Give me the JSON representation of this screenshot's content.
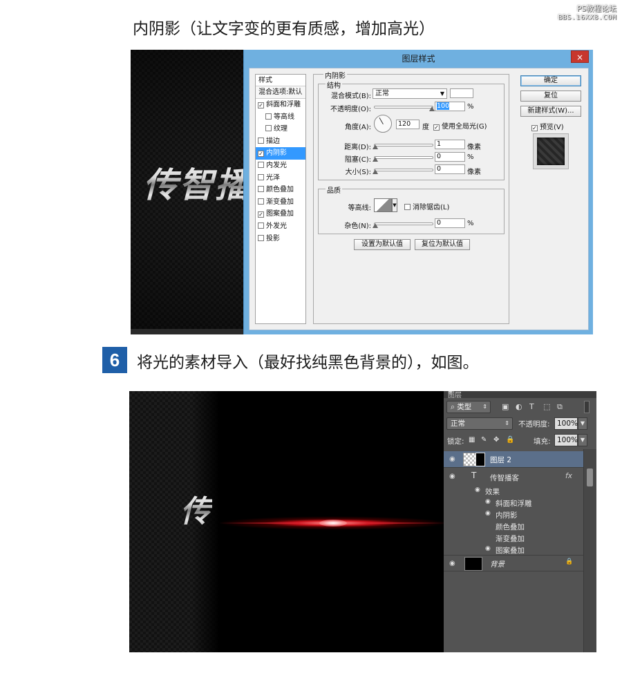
{
  "watermark": {
    "line1": "PS教程论坛",
    "line2": "BBS.16XX8.COM"
  },
  "heading1": "内阴影（让文字变的更有质感，增加高光）",
  "step": {
    "number": "6",
    "text": "将光的素材导入（最好找纯黑色背景的），如图。"
  },
  "shot1": {
    "canvas_text": "传智播",
    "dialog": {
      "title": "图层样式",
      "close": "×",
      "styles_header": "样式",
      "blend_options": "混合选项:默认",
      "style_items": [
        {
          "label": "斜面和浮雕",
          "checked": "✓",
          "sub": false,
          "selected": false
        },
        {
          "label": "等高线",
          "checked": "",
          "sub": true,
          "selected": false
        },
        {
          "label": "纹理",
          "checked": "",
          "sub": true,
          "selected": false
        },
        {
          "label": "描边",
          "checked": "",
          "sub": false,
          "selected": false
        },
        {
          "label": "内阴影",
          "checked": "✓",
          "sub": false,
          "selected": true
        },
        {
          "label": "内发光",
          "checked": "",
          "sub": false,
          "selected": false
        },
        {
          "label": "光泽",
          "checked": "",
          "sub": false,
          "selected": false
        },
        {
          "label": "颜色叠加",
          "checked": "",
          "sub": false,
          "selected": false
        },
        {
          "label": "渐变叠加",
          "checked": "",
          "sub": false,
          "selected": false
        },
        {
          "label": "图案叠加",
          "checked": "✓",
          "sub": false,
          "selected": false
        },
        {
          "label": "外发光",
          "checked": "",
          "sub": false,
          "selected": false
        },
        {
          "label": "投影",
          "checked": "",
          "sub": false,
          "selected": false
        }
      ],
      "section_title": "内阴影",
      "structure_title": "结构",
      "blend_mode_label": "混合模式(B):",
      "blend_mode_value": "正常",
      "opacity_label": "不透明度(O):",
      "opacity_value": "100",
      "percent": "%",
      "angle_label": "角度(A):",
      "angle_value": "120",
      "degree_unit": "度",
      "global_light_label": "使用全局光(G)",
      "global_light_checked": "✓",
      "distance_label": "距离(D):",
      "distance_value": "1",
      "choke_label": "阻塞(C):",
      "choke_value": "0",
      "size_label": "大小(S):",
      "size_value": "0",
      "pixel_unit": "像素",
      "quality_title": "品质",
      "contour_label": "等高线:",
      "antialias_label": "消除锯齿(L)",
      "noise_label": "杂色(N):",
      "noise_value": "0",
      "set_default": "设置为默认值",
      "reset_default": "复位为默认值",
      "ok": "确定",
      "reset": "复位",
      "new_style": "新建样式(W)...",
      "preview_label": "预览(V)",
      "preview_checked": "✓"
    }
  },
  "shot2": {
    "canvas_text": "传",
    "layers_panel": {
      "tab": "图层",
      "filter_kind": "类型",
      "filter_icons": [
        "image-filter-icon",
        "adjustment-filter-icon",
        "type-filter-icon",
        "shape-filter-icon",
        "smart-object-filter-icon"
      ],
      "filter_glyphs": [
        "▣",
        "◐",
        "T",
        "⬚",
        "⧉"
      ],
      "blend_mode": "正常",
      "opacity_label": "不透明度:",
      "opacity_value": "100%",
      "lock_label": "锁定:",
      "lock_glyphs": [
        "▦",
        "✎",
        "✥",
        "🔒"
      ],
      "fill_label": "填充:",
      "fill_value": "100%",
      "layers": [
        {
          "name": "图层 2"
        },
        {
          "name": "传智播客",
          "fx": "fx"
        },
        {
          "name": "背景"
        }
      ],
      "effects_label": "效果",
      "effects": [
        "斜面和浮雕",
        "内阴影",
        "颜色叠加",
        "渐变叠加",
        "图案叠加"
      ],
      "eye_glyph": "◉",
      "text_layer_glyph": "T"
    }
  }
}
